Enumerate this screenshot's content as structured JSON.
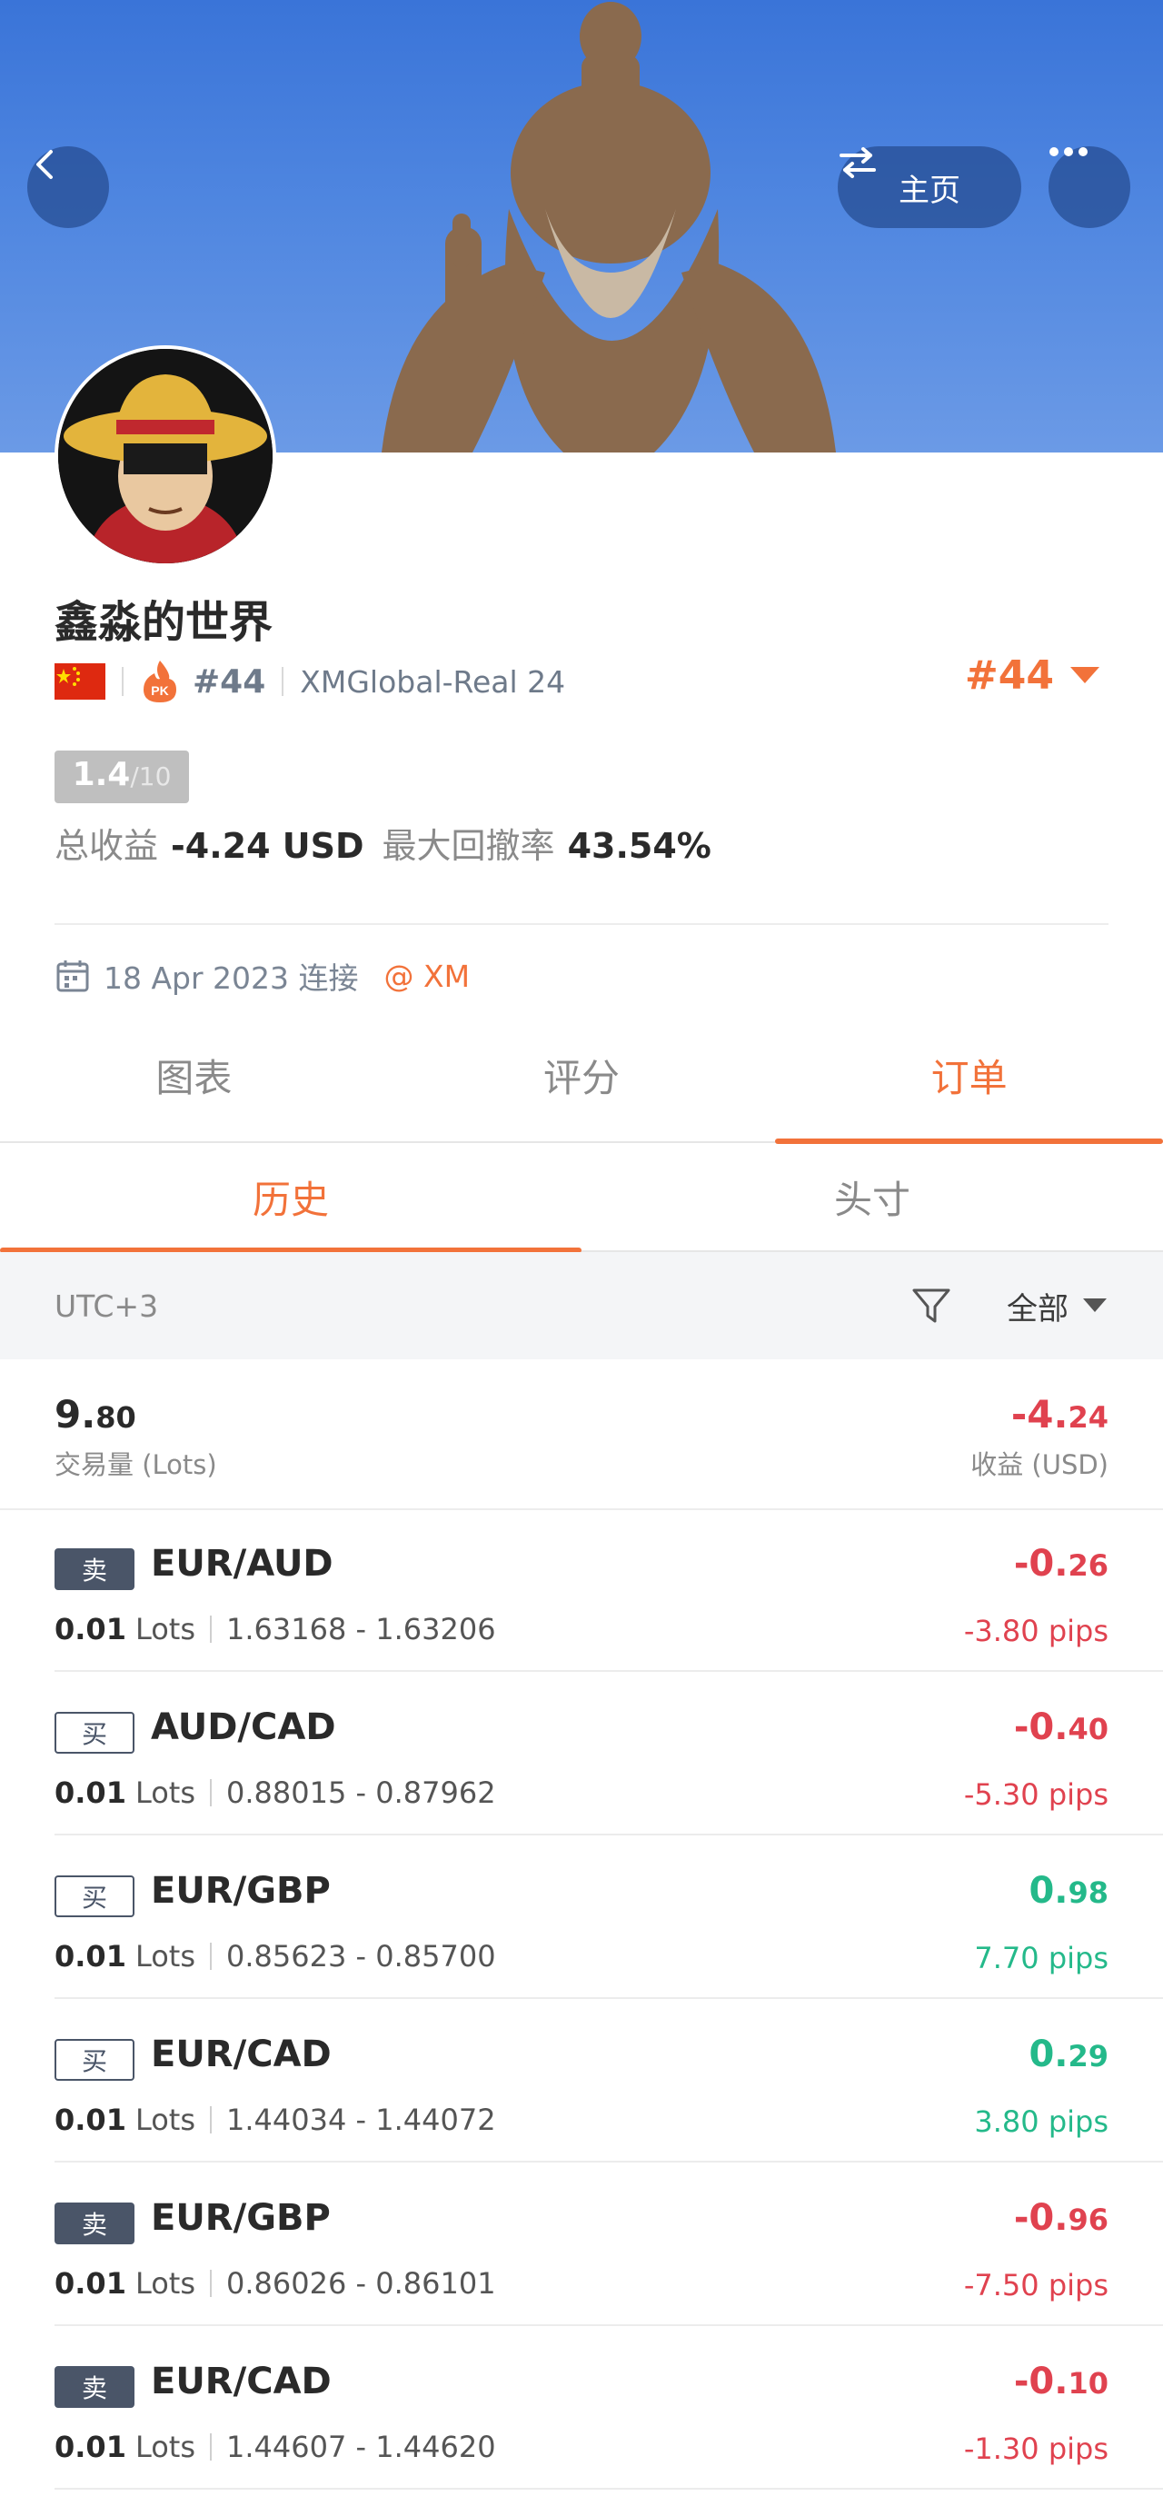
{
  "header": {
    "home_label": "主页",
    "back_icon": "chevron-left-icon",
    "swap_icon": "swap-arrows-icon",
    "more_icon": "more-dots-icon"
  },
  "profile": {
    "name": "鑫淼的世界",
    "country_flag": "china-flag-icon",
    "pk_badge": "PK",
    "rank_small": "#44",
    "server": "XMGlobal-Real 24",
    "rank_big": "#44",
    "score": "1.4",
    "score_max": "/10",
    "total_profit_label": "总收益",
    "total_profit_value": "-4.24 USD",
    "max_drawdown_label": "最大回撤率",
    "max_drawdown_value": "43.54%",
    "connect_date": "18 Apr 2023 连接",
    "broker": "@ XM",
    "accent_color": "#f2723a"
  },
  "tabs": {
    "main": [
      "图表",
      "评分",
      "订单"
    ],
    "main_active": "订单",
    "sub": [
      "历史",
      "头寸"
    ],
    "sub_active": "历史"
  },
  "filter": {
    "timezone": "UTC+3",
    "filter_icon": "funnel-icon",
    "selection": "全部"
  },
  "summary": {
    "volume_int": "9.",
    "volume_dec": "80",
    "volume_label": "交易量 (Lots)",
    "profit_int": "-4.",
    "profit_dec": "24",
    "profit_label": "收益 (USD)"
  },
  "orders": [
    {
      "side": "卖",
      "type": "sell",
      "pair": "EUR/AUD",
      "lots": "0.01",
      "lots_unit": "Lots",
      "prices": "1.63168 - 1.63206",
      "profit_int": "-0.",
      "profit_dec": "26",
      "pips": "-3.80 pips",
      "positive": false
    },
    {
      "side": "买",
      "type": "buy",
      "pair": "AUD/CAD",
      "lots": "0.01",
      "lots_unit": "Lots",
      "prices": "0.88015 - 0.87962",
      "profit_int": "-0.",
      "profit_dec": "40",
      "pips": "-5.30 pips",
      "positive": false
    },
    {
      "side": "买",
      "type": "buy",
      "pair": "EUR/GBP",
      "lots": "0.01",
      "lots_unit": "Lots",
      "prices": "0.85623 - 0.85700",
      "profit_int": "0.",
      "profit_dec": "98",
      "pips": "7.70 pips",
      "positive": true
    },
    {
      "side": "买",
      "type": "buy",
      "pair": "EUR/CAD",
      "lots": "0.01",
      "lots_unit": "Lots",
      "prices": "1.44034 - 1.44072",
      "profit_int": "0.",
      "profit_dec": "29",
      "pips": "3.80 pips",
      "positive": true
    },
    {
      "side": "卖",
      "type": "sell",
      "pair": "EUR/GBP",
      "lots": "0.01",
      "lots_unit": "Lots",
      "prices": "0.86026 - 0.86101",
      "profit_int": "-0.",
      "profit_dec": "96",
      "pips": "-7.50 pips",
      "positive": false
    },
    {
      "side": "卖",
      "type": "sell",
      "pair": "EUR/CAD",
      "lots": "0.01",
      "lots_unit": "Lots",
      "prices": "1.44607 - 1.44620",
      "profit_int": "-0.",
      "profit_dec": "10",
      "pips": "-1.30 pips",
      "positive": false
    }
  ]
}
